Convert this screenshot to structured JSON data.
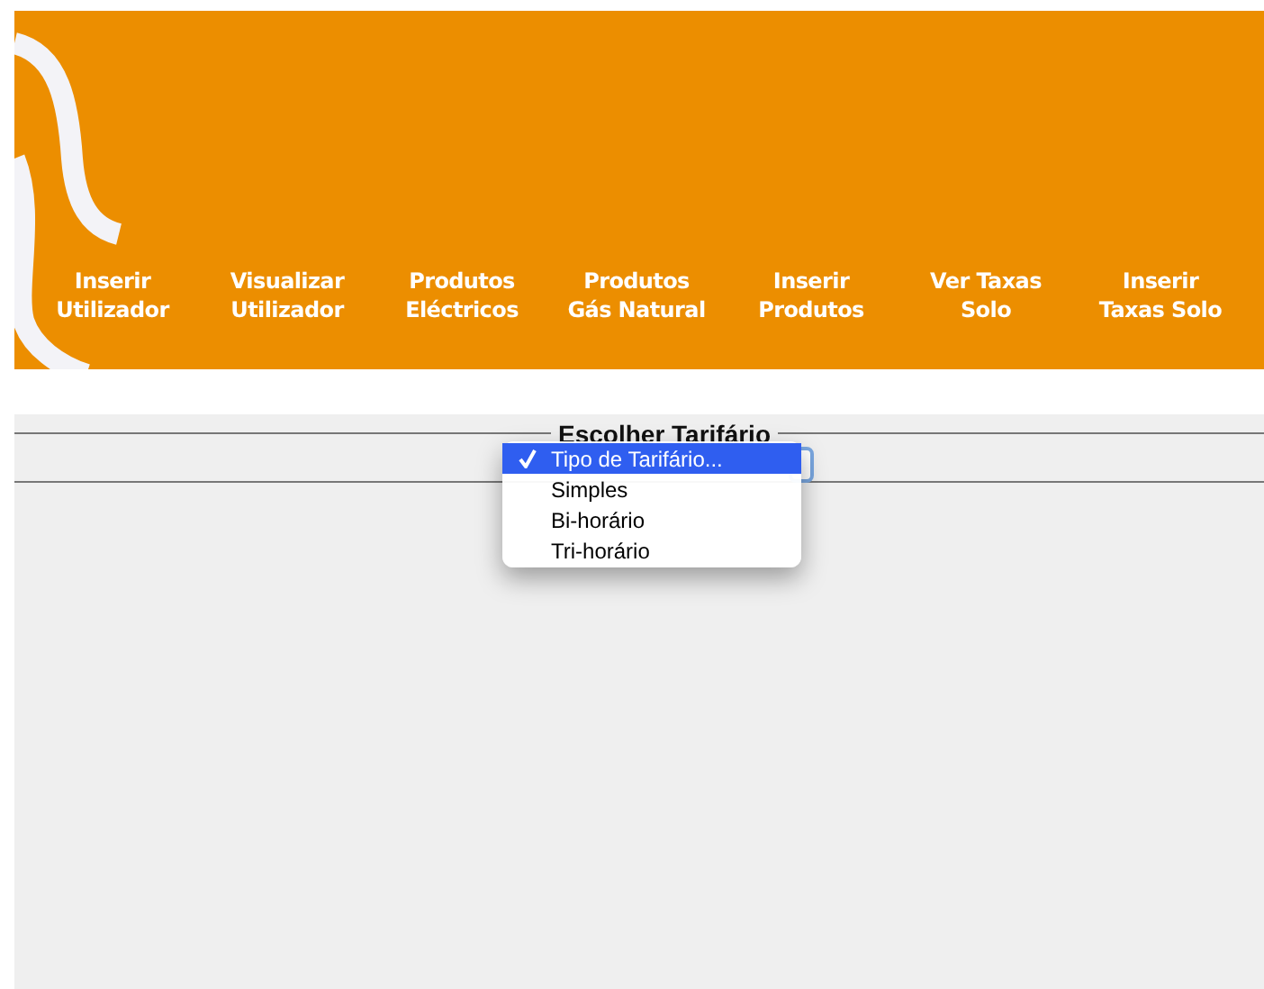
{
  "nav": [
    {
      "label": "Inserir\nUtilizador"
    },
    {
      "label": "Visualizar\nUtilizador"
    },
    {
      "label": "Produtos\nEléctricos"
    },
    {
      "label": "Produtos\nGás Natural"
    },
    {
      "label": "Inserir\nProdutos"
    },
    {
      "label": "Ver Taxas\nSolo"
    },
    {
      "label": "Inserir\nTaxas Solo"
    }
  ],
  "form": {
    "legend": "Escolher Tarifário",
    "select": {
      "expanded": true,
      "options": [
        {
          "label": "Tipo de Tarifário...",
          "selected": true
        },
        {
          "label": "Simples",
          "selected": false
        },
        {
          "label": "Bi-horário",
          "selected": false
        },
        {
          "label": "Tri-horário",
          "selected": false
        }
      ]
    }
  }
}
